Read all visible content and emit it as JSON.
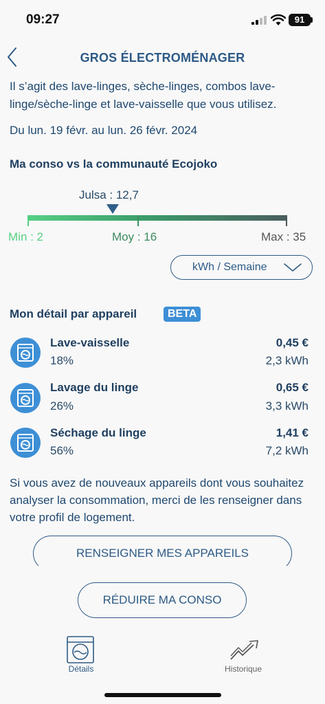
{
  "status_bar": {
    "time": "09:27",
    "battery": "91"
  },
  "header": {
    "title": "GROS ÉLECTROMÉNAGER"
  },
  "description": "Il s’agit des lave-linges, sèche-linges, combos lave-linge/sèche-linge et lave-vaisselle que vous utilisez.",
  "period": "Du lun. 19 févr. au lun. 26 févr. 2024",
  "comparison": {
    "title": "Ma conso vs la communauté Ecojoko",
    "user_label": "Julsa : 12,7",
    "user_value": 12.7,
    "min_label": "Min : 2",
    "avg_label": "Moy : 16",
    "max_label": "Max : 35",
    "min": 2,
    "avg": 16,
    "max": 35,
    "unit_selector": "kWh / Semaine"
  },
  "detail": {
    "title": "Mon détail par appareil",
    "badge": "BETA",
    "appliances": [
      {
        "name": "Lave-vaisselle",
        "percent": "18%",
        "cost": "0,45 €",
        "energy": "2,3 kWh",
        "icon": "washing-machine-icon"
      },
      {
        "name": "Lavage du linge",
        "percent": "26%",
        "cost": "0,65 €",
        "energy": "3,3 kWh",
        "icon": "washing-machine-icon"
      },
      {
        "name": "Séchage du linge",
        "percent": "56%",
        "cost": "1,41 €",
        "energy": "7,2 kWh",
        "icon": "washing-machine-icon"
      }
    ]
  },
  "info_text": "Si vous avez de nouveaux appareils dont vous souhaitez analyser la consommation, merci de les renseigner dans votre profil de logement.",
  "buttons": {
    "declare": "RENSEIGNER MES APPAREILS",
    "reduce": "RÉDUIRE MA CONSO"
  },
  "tabs": [
    {
      "label": "Détails",
      "icon": "washing-machine-icon",
      "active": true
    },
    {
      "label": "Historique",
      "icon": "trend-chart-icon",
      "active": false
    }
  ],
  "colors": {
    "primary": "#2d5a86",
    "accent_badge": "#3d8fd6",
    "gauge_start": "#57cf85",
    "gauge_end": "#4a5e5f"
  }
}
